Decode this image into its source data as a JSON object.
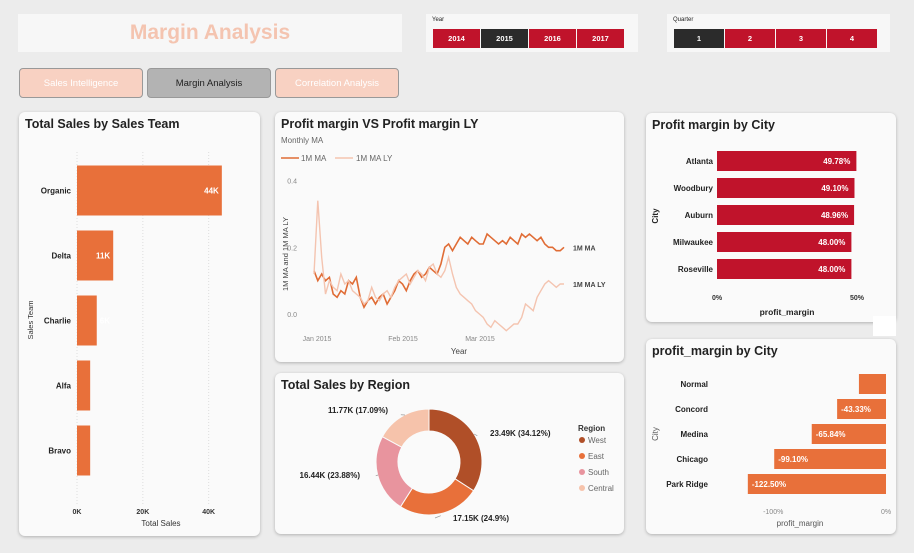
{
  "header": {
    "title": "Margin Analysis"
  },
  "slicers": {
    "year": {
      "title": "Year",
      "options": [
        "2014",
        "2015",
        "2016",
        "2017"
      ],
      "selected": "2015"
    },
    "quarter": {
      "title": "Quarter",
      "options": [
        "1",
        "2",
        "3",
        "4"
      ],
      "selected": "1"
    }
  },
  "nav": {
    "items": [
      "Sales Intelligence",
      "Margin Analysis",
      "Correlation Analysis"
    ],
    "active": "Margin Analysis"
  },
  "colors": {
    "accent": "#e8703a",
    "crimson": "#c0132b",
    "dark": "#2b2b2b",
    "title_pink": "#f4c4b0",
    "nav_pink": "#f8d1c2",
    "nav_gray": "#b3b3b3"
  },
  "chart_data": [
    {
      "id": "sales-team",
      "type": "bar",
      "orientation": "horizontal",
      "title": "Total Sales by Sales Team",
      "categories": [
        "Organic",
        "Delta",
        "Charlie",
        "Alfa",
        "Bravo"
      ],
      "values": [
        44,
        11,
        6,
        4,
        4
      ],
      "data_labels": [
        "44K",
        "11K",
        "6K",
        "",
        ""
      ],
      "xlabel": "Total Sales",
      "ylabel": "Sales Team",
      "xticks": [
        "0K",
        "20K",
        "40K"
      ],
      "xlim": [
        0,
        48
      ],
      "color": "#e8703a"
    },
    {
      "id": "pm-vs-ly",
      "type": "line",
      "title": "Profit margin VS Profit margin LY",
      "subtitle": "Monthly MA",
      "series": [
        {
          "name": "1M MA",
          "end_label": "1M MA",
          "color": "#e06c35",
          "values": [
            0.13,
            0.1,
            0.12,
            0.1,
            0.11,
            0.06,
            0.05,
            0.07,
            0.06,
            0.1,
            0.09,
            0.11,
            0.05,
            0.02,
            0.04,
            0.05,
            0.03,
            0.05,
            0.06,
            0.03,
            0.05,
            0.07,
            0.1,
            0.09,
            0.07,
            0.1,
            0.12,
            0.13,
            0.11,
            0.12,
            0.14,
            0.13,
            0.12,
            0.15,
            0.2,
            0.21,
            0.19,
            0.21,
            0.23,
            0.22,
            0.21,
            0.23,
            0.22,
            0.21,
            0.21,
            0.24,
            0.23,
            0.22,
            0.21,
            0.22,
            0.21,
            0.23,
            0.22,
            0.21,
            0.24,
            0.23,
            0.24,
            0.23,
            0.22,
            0.23,
            0.21,
            0.2,
            0.2,
            0.19,
            0.19,
            0.2
          ]
        },
        {
          "name": "1M MA LY",
          "end_label": "1M MA LY",
          "color": "#f4c4b0",
          "values": [
            0.12,
            0.34,
            0.17,
            0.06,
            0.1,
            0.08,
            0.07,
            0.12,
            0.09,
            0.1,
            0.07,
            0.06,
            0.05,
            0.03,
            0.04,
            0.08,
            0.05,
            0.04,
            0.06,
            0.07,
            0.05,
            0.08,
            0.1,
            0.11,
            0.12,
            0.09,
            0.11,
            0.13,
            0.12,
            0.1,
            0.14,
            0.15,
            0.12,
            0.11,
            0.13,
            0.17,
            0.12,
            0.08,
            0.06,
            0.05,
            0.04,
            0.03,
            0.01,
            0.0,
            -0.01,
            -0.03,
            -0.04,
            -0.02,
            -0.03,
            -0.04,
            -0.05,
            -0.04,
            -0.03,
            -0.03,
            -0.01,
            0.03,
            0.02,
            0.01,
            0.05,
            0.07,
            0.09,
            0.1,
            0.09,
            0.08,
            0.09,
            0.09
          ]
        }
      ],
      "xticks": [
        "Jan 2015",
        "Feb 2015",
        "Mar 2015"
      ],
      "xlabel": "Year",
      "ylabel": "1M MA and 1M MA LY",
      "yticks": [
        "0.0",
        "0.2",
        "0.4"
      ],
      "ylim": [
        -0.06,
        0.42
      ]
    },
    {
      "id": "region",
      "type": "pie",
      "donut": true,
      "title": "Total Sales by Region",
      "legend_title": "Region",
      "slices": [
        {
          "name": "West",
          "label": "23.49K (34.12%)",
          "value": 34.12,
          "color": "#b04f28"
        },
        {
          "name": "East",
          "label": "17.15K (24.9%)",
          "value": 24.9,
          "color": "#e8703a"
        },
        {
          "name": "South",
          "label": "16.44K (23.88%)",
          "value": 23.88,
          "color": "#e8949e"
        },
        {
          "name": "Central",
          "label": "11.77K (17.09%)",
          "value": 17.09,
          "color": "#f6c3ab"
        }
      ],
      "legend_position": "right"
    },
    {
      "id": "pm-city-top",
      "type": "bar",
      "orientation": "horizontal",
      "title": "Profit margin by City",
      "categories": [
        "Atlanta",
        "Woodbury",
        "Auburn",
        "Milwaukee",
        "Roseville"
      ],
      "values": [
        49.78,
        49.1,
        48.96,
        48.0,
        48.0
      ],
      "data_labels": [
        "49.78%",
        "49.10%",
        "48.96%",
        "48.00%",
        "48.00%"
      ],
      "xlabel": "profit_margin",
      "ylabel": "City",
      "xticks": [
        "0%",
        "50%"
      ],
      "xlim": [
        0,
        50
      ],
      "color": "#c0132b"
    },
    {
      "id": "pm-city-bottom",
      "type": "bar",
      "orientation": "horizontal",
      "title": "profit_margin by City",
      "categories": [
        "Normal",
        "Concord",
        "Medina",
        "Chicago",
        "Park Ridge"
      ],
      "values": [
        -24,
        -43.33,
        -65.84,
        -99.1,
        -122.5
      ],
      "data_labels": [
        "",
        "-43.33%",
        "-65.84%",
        "-99.10%",
        "-122.50%"
      ],
      "xlabel": "profit_margin",
      "ylabel": "City",
      "xticks": [
        "-100%",
        "0%"
      ],
      "xlim": [
        -125,
        0
      ],
      "color": "#e8703a"
    }
  ]
}
